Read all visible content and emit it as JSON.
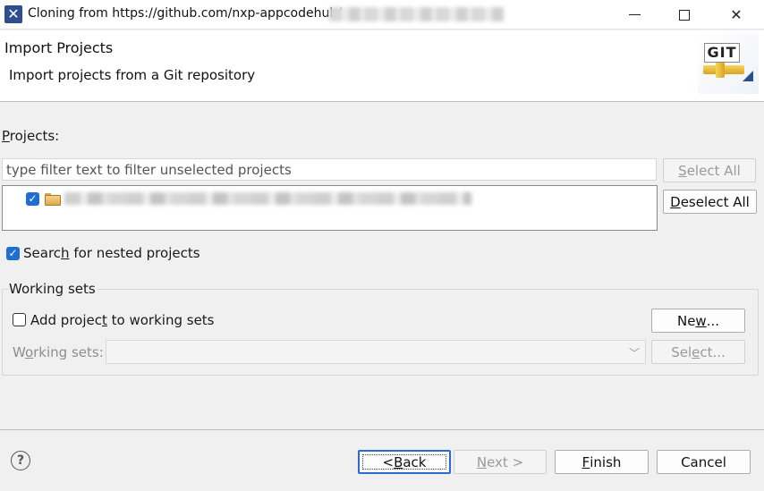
{
  "window": {
    "title": "Cloning from https://github.com/nxp-appcodehub/"
  },
  "header": {
    "title": "Import Projects",
    "subtitle": "Import projects from a Git repository",
    "logo_text": "GIT"
  },
  "projects": {
    "label_prefix": "",
    "label_mnemonic": "P",
    "label_rest": "rojects:",
    "filter_placeholder": "type filter text to filter unselected projects",
    "filter_value": "",
    "select_all": {
      "mnemonic": "S",
      "rest": "elect All",
      "enabled": false
    },
    "deselect_all": {
      "mnemonic": "D",
      "rest": "eselect All",
      "enabled": true
    },
    "items": [
      {
        "checked": true,
        "icon": "folder-icon"
      }
    ]
  },
  "nested": {
    "checked": true,
    "label_before": "Searc",
    "label_mnemonic": "h",
    "label_after": " for nested projects"
  },
  "working_sets": {
    "group_title": "Working sets",
    "add_checked": false,
    "add_before": "Add projec",
    "add_mnemonic": "t",
    "add_after": " to working sets",
    "new_before": "Ne",
    "new_mnemonic": "w",
    "new_after": "...",
    "ws_label_before": "W",
    "ws_label_mnemonic": "o",
    "ws_label_after": "rking sets:",
    "select_before": "Sel",
    "select_mnemonic": "e",
    "select_after": "ct..."
  },
  "footer": {
    "back_before": "< ",
    "back_mnemonic": "B",
    "back_after": "ack",
    "next_mnemonic": "N",
    "next_after": "ext >",
    "finish_mnemonic": "F",
    "finish_after": "inish",
    "cancel": "Cancel"
  },
  "colors": {
    "accent": "#1f6fd1",
    "focus_border": "#2c6bd0",
    "background": "#f0f0f0"
  }
}
